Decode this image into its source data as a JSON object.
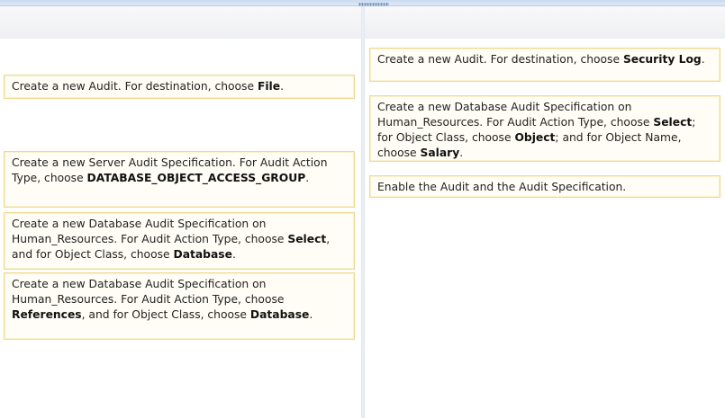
{
  "left_pane": {
    "items": [
      {
        "parts": [
          "Create a new Audit. For destination, choose ",
          "File",
          "."
        ]
      },
      {
        "parts": [
          "Create a new Server Audit Specification. For Audit Action Type, choose ",
          "DATABASE_OBJECT_ACCESS_GROUP",
          "."
        ]
      },
      {
        "parts": [
          "Create a new Database Audit Specification on Human_Resources. For Audit Action Type, choose ",
          "Select",
          ", and for Object Class, choose ",
          "Database",
          "."
        ]
      },
      {
        "parts": [
          "Create a new Database Audit Specification on Human_Resources. For Audit Action Type, choose ",
          "References",
          ", and for Object Class, choose ",
          "Database",
          "."
        ]
      }
    ]
  },
  "right_pane": {
    "items": [
      {
        "parts": [
          "Create a new Audit. For destination, choose ",
          "Security Log",
          "."
        ]
      },
      {
        "parts": [
          "Create a new Database Audit Specification on Human_Resources. For Audit Action Type, choose ",
          "Select",
          "; for Object Class, choose ",
          "Object",
          "; and for Object Name, choose ",
          "Salary",
          "."
        ]
      },
      {
        "parts": [
          "Enable the Audit and the Audit Specification."
        ]
      }
    ]
  }
}
